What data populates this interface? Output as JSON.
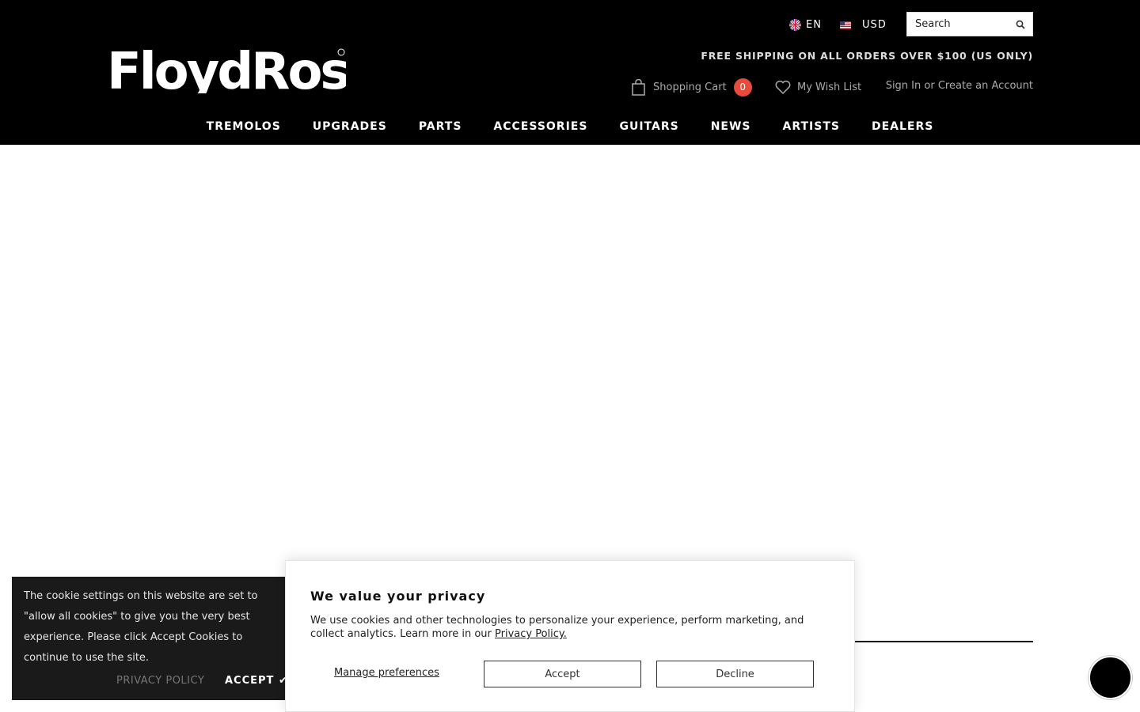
{
  "header": {
    "logo_text": "FloydRose",
    "language": "EN",
    "currency": "USD",
    "search": {
      "placeholder": "Search"
    },
    "free_shipping": "FREE SHIPPING ON ALL ORDERS OVER $100 (US ONLY)",
    "cart": {
      "label": "Shopping Cart",
      "count": "0"
    },
    "wishlist_label": "My Wish List",
    "sign_in": "Sign In",
    "or_text": "or",
    "create_account": "Create an Account"
  },
  "nav": {
    "items": [
      {
        "label": "TREMOLOS"
      },
      {
        "label": "UPGRADES"
      },
      {
        "label": "PARTS"
      },
      {
        "label": "ACCESSORIES"
      },
      {
        "label": "GUITARS"
      },
      {
        "label": "NEWS"
      },
      {
        "label": "ARTISTS"
      },
      {
        "label": "DEALERS"
      }
    ]
  },
  "cookie_banner": {
    "text": "The cookie settings on this website are set to \"allow all cookies\" to give you the very best experience. Please click Accept Cookies to continue to use the site.",
    "privacy_label": "PRIVACY POLICY",
    "accept_label": "ACCEPT ✔"
  },
  "privacy_modal": {
    "title": "We value your privacy",
    "body": "We use cookies and other technologies to personalize your experience, perform marketing, and collect analytics. Learn more in our",
    "link_label": "Privacy Policy.",
    "manage_label": "Manage preferences",
    "accept_label": "Accept",
    "decline_label": "Decline"
  },
  "colors": {
    "header_bg": "#000000",
    "cart_badge": "#e84a3c",
    "banner_bg": "#1a1a1a"
  },
  "icons": [
    "search-icon",
    "cart-icon",
    "heart-icon",
    "uk-flag-icon",
    "us-flag-icon",
    "chat-icon"
  ]
}
